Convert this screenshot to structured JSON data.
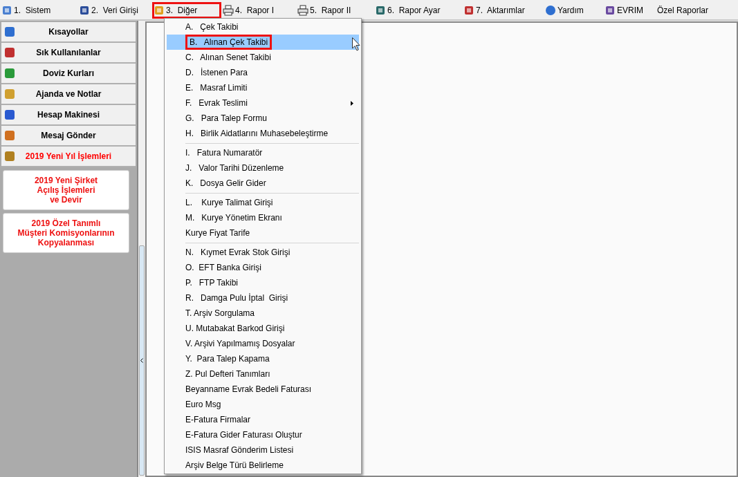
{
  "menubar": [
    {
      "label": "1.  Sistem",
      "marked": false
    },
    {
      "label": "2.  Veri Girişi",
      "marked": false
    },
    {
      "label": "3.  Diğer",
      "marked": true
    },
    {
      "label": "4.  Rapor I",
      "marked": false
    },
    {
      "label": "5.  Rapor II",
      "marked": false
    },
    {
      "label": "6.  Rapor Ayar",
      "marked": false
    },
    {
      "label": "7.  Aktarımlar",
      "marked": false
    },
    {
      "label": "Yardım",
      "marked": false
    },
    {
      "label": "EVRIM",
      "marked": false
    },
    {
      "label": "Özel Raporlar",
      "marked": false
    }
  ],
  "sidebar": {
    "items": [
      {
        "label": "Kısayollar",
        "color": "#000000"
      },
      {
        "label": "Sık Kullanılanlar",
        "color": "#000000"
      },
      {
        "label": "Doviz Kurları",
        "color": "#000000"
      },
      {
        "label": "Ajanda ve Notlar",
        "color": "#000000"
      },
      {
        "label": "Hesap Makinesi",
        "color": "#000000"
      },
      {
        "label": "Mesaj Gönder",
        "color": "#000000"
      },
      {
        "label": "2019 Yeni Yıl İşlemleri",
        "color": "#ff0000"
      }
    ],
    "cards": [
      {
        "label": "2019 Yeni Şirket\nAçılış İşlemleri\nve Devir"
      },
      {
        "label": "2019 Özel Tanımlı\nMüşteri Komisyonlarının\nKopyalanması"
      }
    ]
  },
  "dropdown": {
    "items": [
      {
        "kind": "item",
        "label": "A.   Çek Takibi",
        "selected": false,
        "marked": false,
        "submenu": false
      },
      {
        "kind": "item",
        "label": "B.   Alınan Çek Takibi",
        "selected": true,
        "marked": true,
        "submenu": false
      },
      {
        "kind": "item",
        "label": "C.   Alınan Senet Takibi",
        "selected": false,
        "marked": false,
        "submenu": false
      },
      {
        "kind": "item",
        "label": "D.   İstenen Para",
        "selected": false,
        "marked": false,
        "submenu": false
      },
      {
        "kind": "item",
        "label": "E.   Masraf Limiti",
        "selected": false,
        "marked": false,
        "submenu": false
      },
      {
        "kind": "item",
        "label": "F.   Evrak Teslimi",
        "selected": false,
        "marked": false,
        "submenu": true
      },
      {
        "kind": "item",
        "label": "G.   Para Talep Formu",
        "selected": false,
        "marked": false,
        "submenu": false
      },
      {
        "kind": "item",
        "label": "H.   Birlik Aidatlarını Muhasebeleştirme",
        "selected": false,
        "marked": false,
        "submenu": false
      },
      {
        "kind": "separator"
      },
      {
        "kind": "item",
        "label": "I.   Fatura Numaratör",
        "selected": false,
        "marked": false,
        "submenu": false
      },
      {
        "kind": "item",
        "label": "J.   Valor Tarihi Düzenleme",
        "selected": false,
        "marked": false,
        "submenu": false
      },
      {
        "kind": "item",
        "label": "K.   Dosya Gelir Gider",
        "selected": false,
        "marked": false,
        "submenu": false
      },
      {
        "kind": "separator"
      },
      {
        "kind": "item",
        "label": "L.    Kurye Talimat Girişi",
        "selected": false,
        "marked": false,
        "submenu": false
      },
      {
        "kind": "item",
        "label": "M.   Kurye Yönetim Ekranı",
        "selected": false,
        "marked": false,
        "submenu": false
      },
      {
        "kind": "item",
        "label": "Kurye Fiyat Tarife",
        "selected": false,
        "marked": false,
        "submenu": false
      },
      {
        "kind": "separator"
      },
      {
        "kind": "item",
        "label": "N.   Kıymet Evrak Stok Girişi",
        "selected": false,
        "marked": false,
        "submenu": false
      },
      {
        "kind": "item",
        "label": "O.  EFT Banka Girişi",
        "selected": false,
        "marked": false,
        "submenu": false
      },
      {
        "kind": "item",
        "label": "P.   FTP Takibi",
        "selected": false,
        "marked": false,
        "submenu": false
      },
      {
        "kind": "item",
        "label": "R.   Damga Pulu İptal  Girişi",
        "selected": false,
        "marked": false,
        "submenu": false
      },
      {
        "kind": "item",
        "label": "T. Arşiv Sorgulama",
        "selected": false,
        "marked": false,
        "submenu": false
      },
      {
        "kind": "item",
        "label": "U. Mutabakat Barkod Girişi",
        "selected": false,
        "marked": false,
        "submenu": false
      },
      {
        "kind": "item",
        "label": "V. Arşivi Yapılmamış Dosyalar",
        "selected": false,
        "marked": false,
        "submenu": false
      },
      {
        "kind": "item",
        "label": "Y.  Para Talep Kapama",
        "selected": false,
        "marked": false,
        "submenu": false
      },
      {
        "kind": "item",
        "label": "Z. Pul Defteri Tanımları",
        "selected": false,
        "marked": false,
        "submenu": false
      },
      {
        "kind": "item",
        "label": "Beyanname Evrak Bedeli Faturası",
        "selected": false,
        "marked": false,
        "submenu": false
      },
      {
        "kind": "item",
        "label": "Euro Msg",
        "selected": false,
        "marked": false,
        "submenu": false
      },
      {
        "kind": "item",
        "label": "E-Fatura Firmalar",
        "selected": false,
        "marked": false,
        "submenu": false
      },
      {
        "kind": "item",
        "label": "E-Fatura Gider Faturası Oluştur",
        "selected": false,
        "marked": false,
        "submenu": false
      },
      {
        "kind": "item",
        "label": "ISIS Masraf Gönderim Listesi",
        "selected": false,
        "marked": false,
        "submenu": false
      },
      {
        "kind": "item",
        "label": "Arşiv Belge Türü Belirleme",
        "selected": false,
        "marked": false,
        "submenu": false
      }
    ]
  }
}
